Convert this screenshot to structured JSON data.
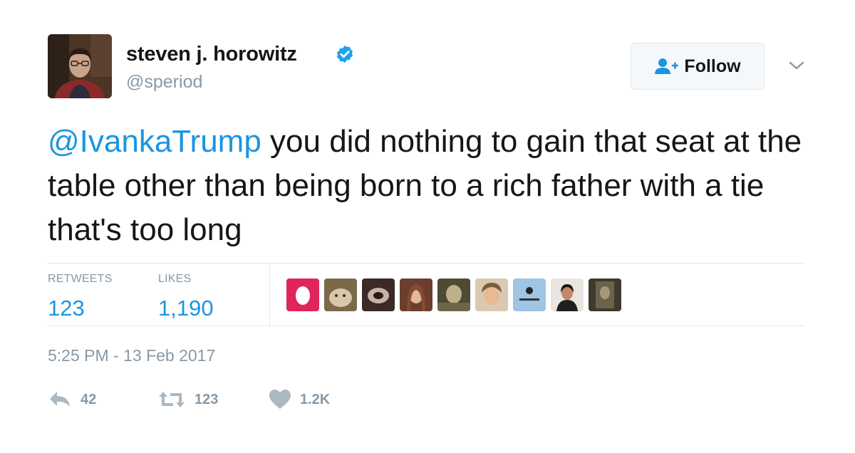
{
  "user": {
    "name": "steven j. horowitz",
    "handle": "@speriod",
    "verified": true,
    "avatar_icon": "profile-photo"
  },
  "follow_button": {
    "label": "Follow",
    "icon": "add-user-icon"
  },
  "menu_icon": "chevron-down-icon",
  "tweet": {
    "mention": "@IvankaTrump",
    "text": " you did nothing to gain that seat at the table other than being born to a rich father with a tie that's too long"
  },
  "stats": {
    "retweets_label": "RETWEETS",
    "retweets_value": "123",
    "likes_label": "LIKES",
    "likes_value": "1,190"
  },
  "likers": [
    "liker-1",
    "liker-2",
    "liker-3",
    "liker-4",
    "liker-5",
    "liker-6",
    "liker-7",
    "liker-8",
    "liker-9"
  ],
  "timestamp": "5:25 PM - 13 Feb 2017",
  "actions": {
    "reply_count": "42",
    "retweet_count": "123",
    "like_count": "1.2K"
  },
  "colors": {
    "link": "#1b95e0",
    "muted": "#8899a6",
    "text": "#14171a",
    "verified": "#1da1f2"
  }
}
